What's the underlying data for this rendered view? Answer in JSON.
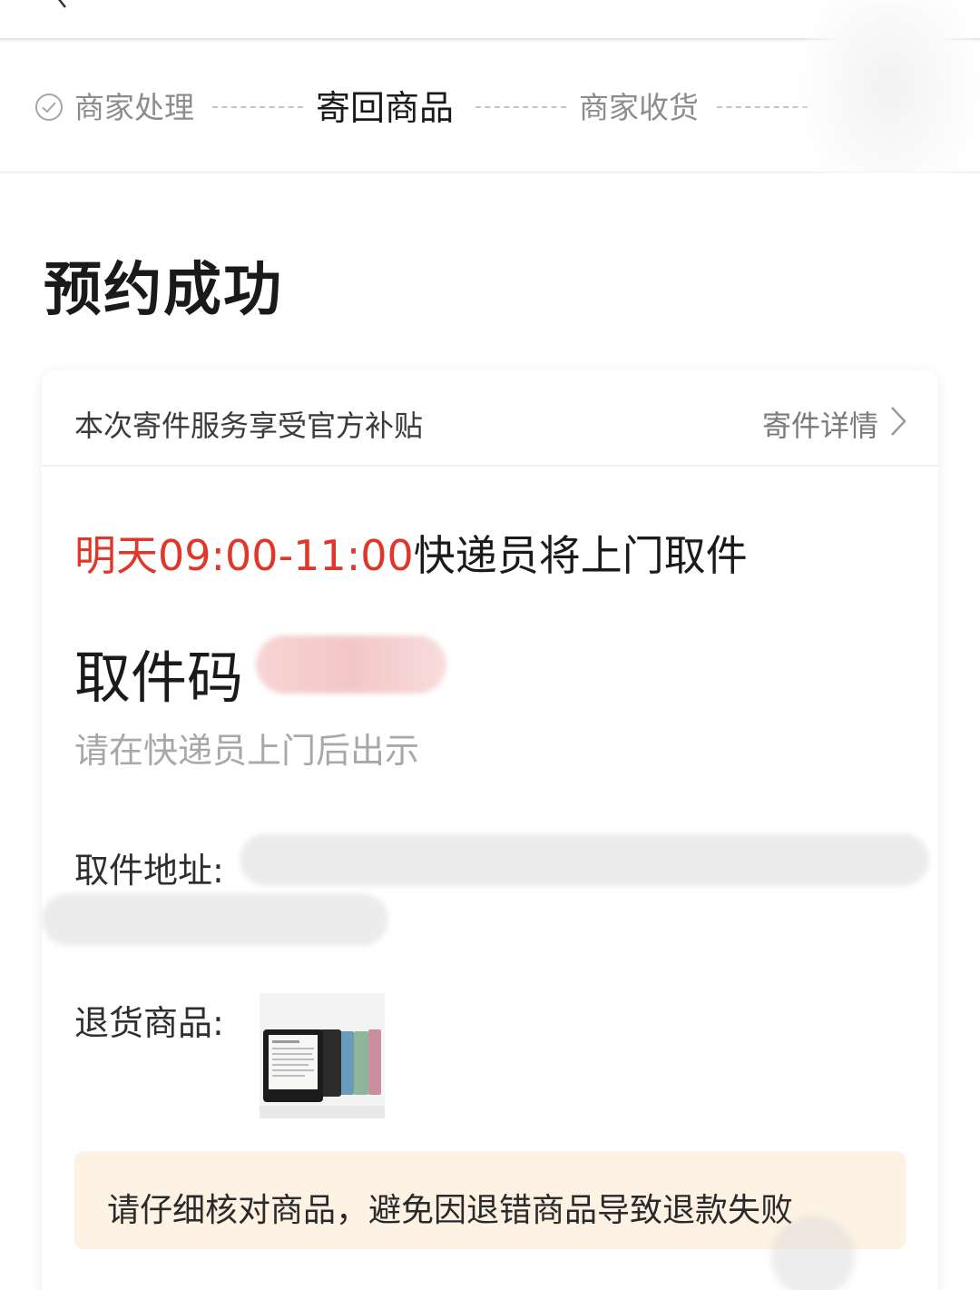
{
  "steps": {
    "step1_label": "商家处理",
    "step2_label": "寄回商品",
    "step3_label": "商家收货"
  },
  "page": {
    "title": "预约成功"
  },
  "card": {
    "subsidy_text": "本次寄件服务享受官方补贴",
    "detail_link": "寄件详情",
    "pickup_time_highlight": "明天09:00-11:00",
    "pickup_time_suffix": "快递员将上门取件",
    "code_label": "取件码",
    "code_hint": "请在快递员上门后出示",
    "address_label": "取件地址:",
    "goods_label": "退货商品:",
    "notice": "请仔细核对商品，避免因退错商品导致退款失败"
  },
  "colors": {
    "accent_red": "#e0372a",
    "notice_bg": "#fdf2e3",
    "muted_text": "#8c8c8c"
  },
  "icons": {
    "back": "chevron-left-icon",
    "step_done": "check-circle-icon",
    "detail": "chevron-right-icon"
  }
}
